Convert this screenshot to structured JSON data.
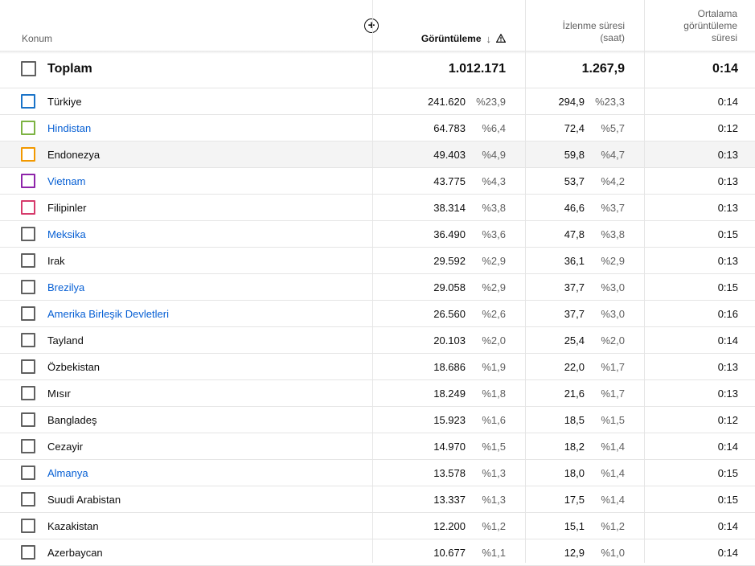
{
  "header": {
    "konum": "Konum",
    "views": "Görüntüleme",
    "watch_line1": "İzlenme süresi",
    "watch_line2": "(saat)",
    "avg_line1": "Ortalama",
    "avg_line2": "görüntüleme",
    "avg_line3": "süresi",
    "sort_icon": "arrow-down-icon",
    "warning_icon": "warning-icon",
    "add_icon": "plus-circle-icon"
  },
  "total": {
    "label": "Toplam",
    "views": "1.012.171",
    "watch": "1.267,9",
    "avg": "0:14"
  },
  "colors": {
    "link": "#065fd4",
    "turkiye": "#1a73c8",
    "hindistan": "#7cb342",
    "endonezya": "#f29900",
    "vietnam": "#8e24aa",
    "filipinler": "#d63a6b",
    "default": "#606060"
  },
  "rows": [
    {
      "name": "Türkiye",
      "link": false,
      "views": "241.620",
      "views_pct": "%23,9",
      "watch": "294,9",
      "watch_pct": "%23,3",
      "avg": "0:14",
      "box_color": "#1a73c8"
    },
    {
      "name": "Hindistan",
      "link": true,
      "views": "64.783",
      "views_pct": "%6,4",
      "watch": "72,4",
      "watch_pct": "%5,7",
      "avg": "0:12",
      "box_color": "#7cb342"
    },
    {
      "name": "Endonezya",
      "link": false,
      "views": "49.403",
      "views_pct": "%4,9",
      "watch": "59,8",
      "watch_pct": "%4,7",
      "avg": "0:13",
      "box_color": "#f29900",
      "highlight": true
    },
    {
      "name": "Vietnam",
      "link": true,
      "views": "43.775",
      "views_pct": "%4,3",
      "watch": "53,7",
      "watch_pct": "%4,2",
      "avg": "0:13",
      "box_color": "#8e24aa"
    },
    {
      "name": "Filipinler",
      "link": false,
      "views": "38.314",
      "views_pct": "%3,8",
      "watch": "46,6",
      "watch_pct": "%3,7",
      "avg": "0:13",
      "box_color": "#d63a6b"
    },
    {
      "name": "Meksika",
      "link": true,
      "views": "36.490",
      "views_pct": "%3,6",
      "watch": "47,8",
      "watch_pct": "%3,8",
      "avg": "0:15",
      "box_color": "#606060"
    },
    {
      "name": "Irak",
      "link": false,
      "views": "29.592",
      "views_pct": "%2,9",
      "watch": "36,1",
      "watch_pct": "%2,9",
      "avg": "0:13",
      "box_color": "#606060"
    },
    {
      "name": "Brezilya",
      "link": true,
      "views": "29.058",
      "views_pct": "%2,9",
      "watch": "37,7",
      "watch_pct": "%3,0",
      "avg": "0:15",
      "box_color": "#606060"
    },
    {
      "name": "Amerika Birleşik Devletleri",
      "link": true,
      "views": "26.560",
      "views_pct": "%2,6",
      "watch": "37,7",
      "watch_pct": "%3,0",
      "avg": "0:16",
      "box_color": "#606060"
    },
    {
      "name": "Tayland",
      "link": false,
      "views": "20.103",
      "views_pct": "%2,0",
      "watch": "25,4",
      "watch_pct": "%2,0",
      "avg": "0:14",
      "box_color": "#606060"
    },
    {
      "name": "Özbekistan",
      "link": false,
      "views": "18.686",
      "views_pct": "%1,9",
      "watch": "22,0",
      "watch_pct": "%1,7",
      "avg": "0:13",
      "box_color": "#606060"
    },
    {
      "name": "Mısır",
      "link": false,
      "views": "18.249",
      "views_pct": "%1,8",
      "watch": "21,6",
      "watch_pct": "%1,7",
      "avg": "0:13",
      "box_color": "#606060"
    },
    {
      "name": "Bangladeş",
      "link": false,
      "views": "15.923",
      "views_pct": "%1,6",
      "watch": "18,5",
      "watch_pct": "%1,5",
      "avg": "0:12",
      "box_color": "#606060"
    },
    {
      "name": "Cezayir",
      "link": false,
      "views": "14.970",
      "views_pct": "%1,5",
      "watch": "18,2",
      "watch_pct": "%1,4",
      "avg": "0:14",
      "box_color": "#606060"
    },
    {
      "name": "Almanya",
      "link": true,
      "views": "13.578",
      "views_pct": "%1,3",
      "watch": "18,0",
      "watch_pct": "%1,4",
      "avg": "0:15",
      "box_color": "#606060"
    },
    {
      "name": "Suudi Arabistan",
      "link": false,
      "views": "13.337",
      "views_pct": "%1,3",
      "watch": "17,5",
      "watch_pct": "%1,4",
      "avg": "0:15",
      "box_color": "#606060"
    },
    {
      "name": "Kazakistan",
      "link": false,
      "views": "12.200",
      "views_pct": "%1,2",
      "watch": "15,1",
      "watch_pct": "%1,2",
      "avg": "0:14",
      "box_color": "#606060"
    },
    {
      "name": "Azerbaycan",
      "link": false,
      "views": "10.677",
      "views_pct": "%1,1",
      "watch": "12,9",
      "watch_pct": "%1,0",
      "avg": "0:14",
      "box_color": "#606060"
    }
  ]
}
